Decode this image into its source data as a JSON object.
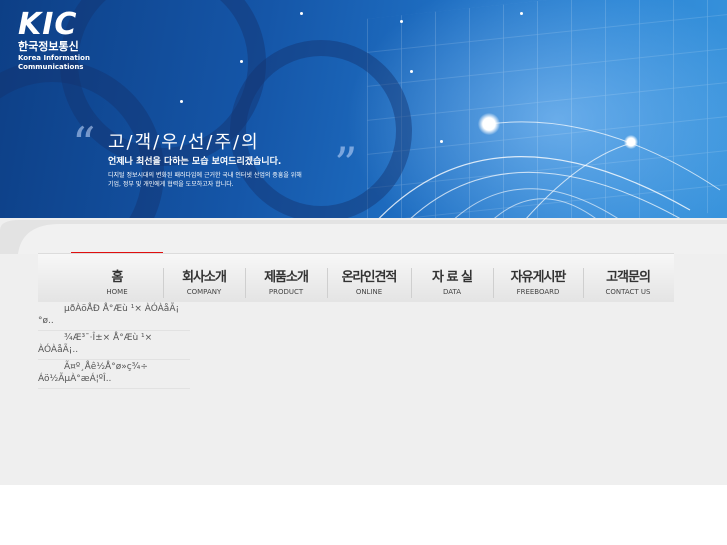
{
  "logo": {
    "mark": "KIC",
    "korean": "한국정보통신",
    "english_line1": "Korea Information",
    "english_line2": "Communications"
  },
  "slogan": {
    "headline": "고/객/우/선/주/의",
    "subline": "언제나 최선을 다하는 모습 보여드리겠습니다.",
    "desc_line1": "디지털 정보시대의 변화된 패러다임에 근거한 국내 인터넷 산업의 중흥을 위해",
    "desc_line2": "기업, 정부 및 개인에게 협력을 도모하고자 합니다."
  },
  "nav": [
    {
      "ko": "홈",
      "en": "HOME"
    },
    {
      "ko": "회사소개",
      "en": "COMPANY"
    },
    {
      "ko": "제품소개",
      "en": "PRODUCT"
    },
    {
      "ko": "온라인견적",
      "en": "ONLINE"
    },
    {
      "ko": "자 료 실",
      "en": "DATA"
    },
    {
      "ko": "자유게시판",
      "en": "FREEBOARD"
    },
    {
      "ko": "고객문의",
      "en": "CONTACT US"
    }
  ],
  "submenu": [
    {
      "line1": "µðÀöÅÐ Å°Æù ¹× ÀÓÀåÃ¡",
      "line2": "°ø.."
    },
    {
      "line1": "¾Æ³¯·Î±× Å°Æù ¹×",
      "line2": "ÀÓÀåÃ¡.."
    },
    {
      "line1": "Ã¤º¸Åê½Å°ø»ç¾÷",
      "line2": "Áö½ÃµÀ°æÁ¦ºÎ.."
    }
  ],
  "colors": {
    "active": "#e01010",
    "banner": "#1556a8"
  }
}
